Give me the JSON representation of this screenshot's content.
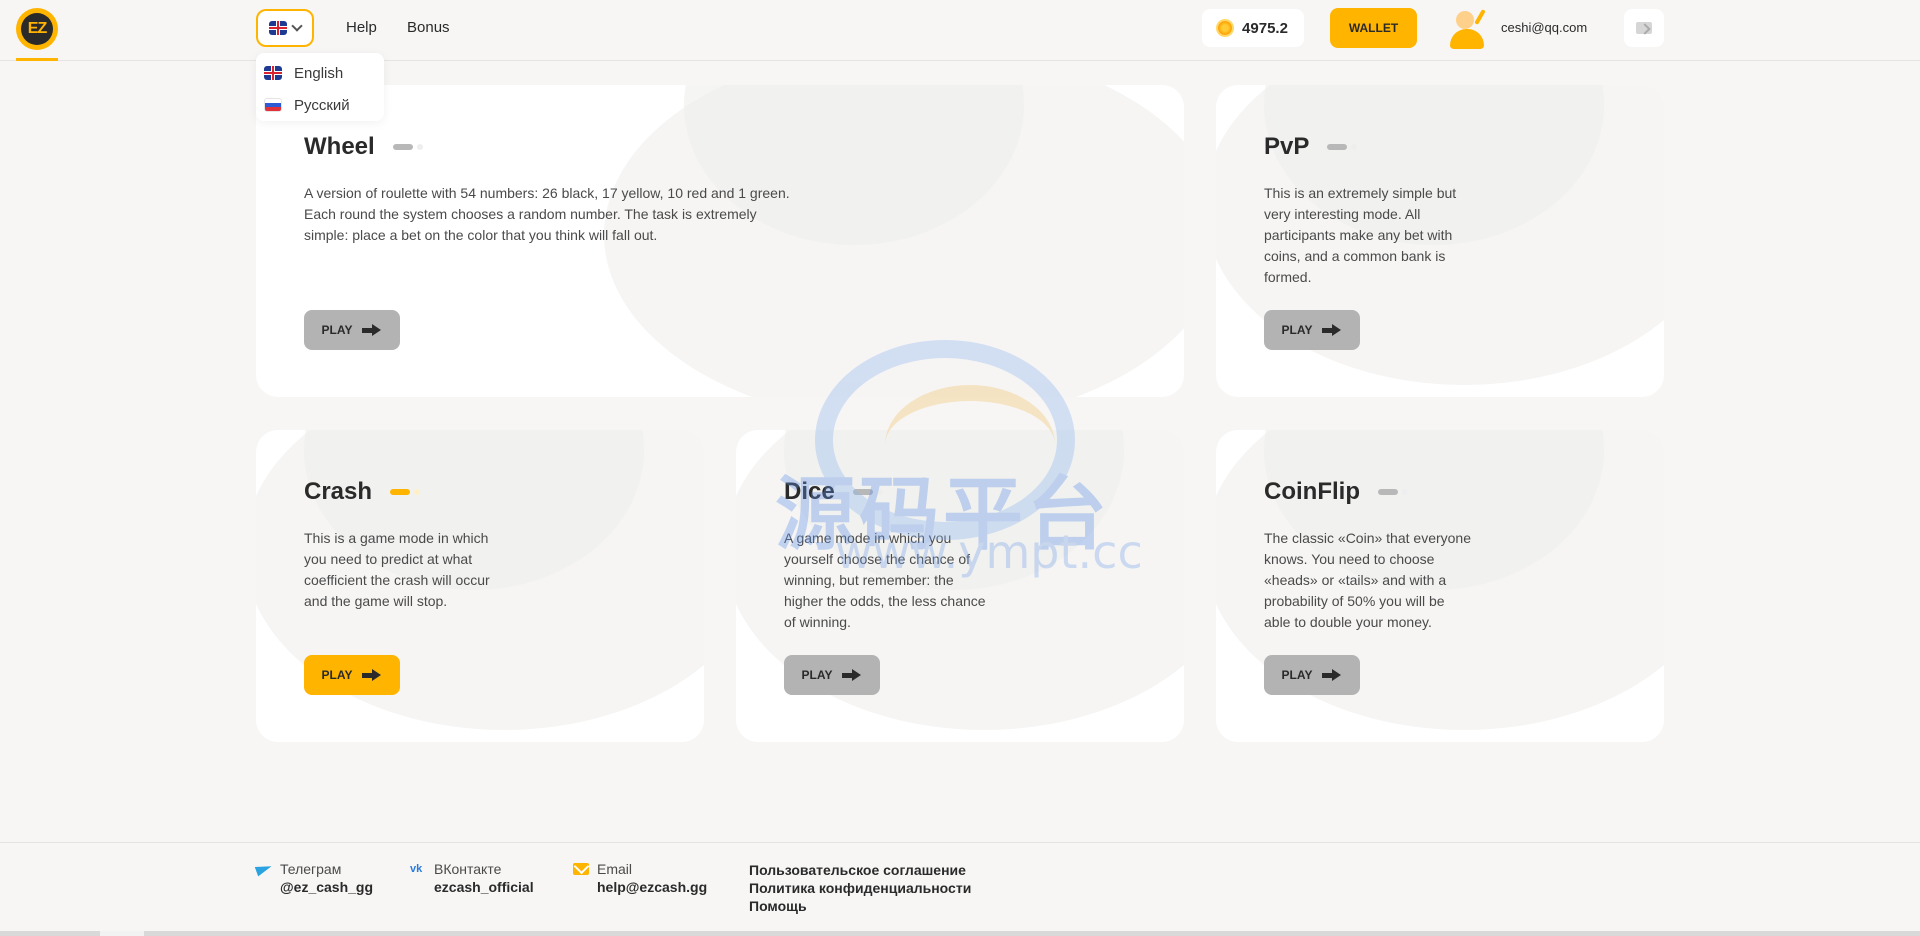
{
  "header": {
    "logo_text": "EZ",
    "nav": [
      {
        "label": "Help"
      },
      {
        "label": "Bonus"
      }
    ],
    "balance": "4975.2",
    "wallet_label": "WALLET",
    "user_email": "ceshi@qq.com"
  },
  "language_menu": {
    "current": "uk-flag",
    "items": [
      {
        "label": "English",
        "flag": "uk-flag"
      },
      {
        "label": "Русский",
        "flag": "ru-flag"
      }
    ]
  },
  "games": [
    {
      "id": "wheel",
      "title": "Wheel",
      "lines": [
        "A version of roulette with 54 numbers: 26 black, 17 yellow, 10 red and 1 green.",
        "Each round the system chooses a random number. The task is extremely",
        "simple: place a bet on the color that you think will fall out."
      ],
      "play_label": "PLAY",
      "active": false
    },
    {
      "id": "pvp",
      "title": "PvP",
      "lines": [
        "This is an extremely simple but",
        "very interesting mode. All",
        "participants make any bet with",
        "coins, and a common bank is",
        "formed."
      ],
      "play_label": "PLAY",
      "active": false
    },
    {
      "id": "crash",
      "title": "Crash",
      "lines": [
        "This is a game mode in which",
        "you need to predict at what",
        "coefficient the crash will occur",
        "and the game will stop."
      ],
      "play_label": "PLAY",
      "active": true
    },
    {
      "id": "dice",
      "title": "Dice",
      "lines": [
        "A game mode in which you",
        "yourself choose the chance of",
        "winning, but remember: the",
        "higher the odds, the less chance",
        "of winning."
      ],
      "play_label": "PLAY",
      "active": false
    },
    {
      "id": "coinflip",
      "title": "CoinFlip",
      "lines": [
        "The classic «Coin» that everyone",
        "knows. You need to choose",
        "«heads» or «tails» and with a",
        "probability of 50% you will be",
        "able to double your money."
      ],
      "play_label": "PLAY",
      "active": false
    }
  ],
  "watermark": {
    "text": "源码平台",
    "url": "www.ympt.cc"
  },
  "footer": {
    "contacts": [
      {
        "label": "Телеграм",
        "value": "@ez_cash_gg",
        "icon": "telegram-icon"
      },
      {
        "label": "ВКонтакте",
        "value": "ezcash_official",
        "icon": "vk-icon"
      },
      {
        "label": "Email",
        "value": "help@ezcash.gg",
        "icon": "mail-icon"
      }
    ],
    "links": [
      {
        "label": "Пользовательское соглашение"
      },
      {
        "label": "Политика конфиденциальности"
      },
      {
        "label": "Помощь"
      }
    ]
  },
  "colors": {
    "accent": "#ffb400",
    "background": "#f7f6f5",
    "card": "#ffffff",
    "button_inactive": "#b3b3b3"
  }
}
